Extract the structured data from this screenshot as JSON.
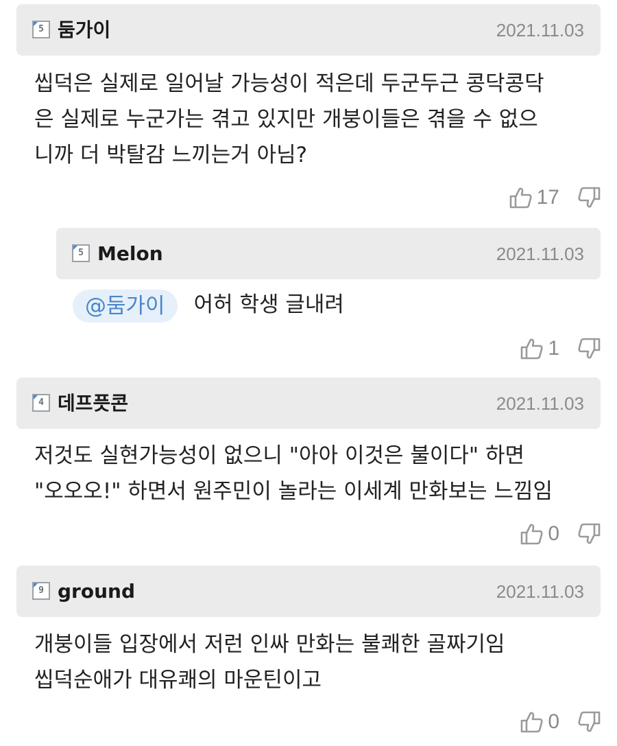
{
  "comments": [
    {
      "level": "5",
      "username": "둠가이",
      "date": "2021.11.03",
      "lines": [
        "씹덕은 실제로 일어날 가능성이 적은데 두군두근 콩닥콩닥",
        "은 실제로 누군가는 겪고 있지만 개붕이들은 겪을 수 없으",
        "니까 더 박탈감 느끼는거 아님?"
      ],
      "likes": "17",
      "reply": {
        "level": "5",
        "username": "Melon",
        "date": "2021.11.03",
        "mention": "@둠가이",
        "text": "어허 학생 글내려",
        "likes": "1"
      }
    },
    {
      "level": "4",
      "username": "데프픗콘",
      "date": "2021.11.03",
      "lines": [
        "저것도 실현가능성이 없으니 \"아아 이것은 불이다\" 하면",
        "\"오오오!\" 하면서 원주민이 놀라는 이세계 만화보는 느낌임"
      ],
      "likes": "0"
    },
    {
      "level": "9",
      "username": "ground",
      "date": "2021.11.03",
      "lines": [
        "개붕이들 입장에서 저런 인싸 만화는 불쾌한 골짜기임",
        "씹덕순애가 대유쾌의 마운틴이고"
      ],
      "likes": "0"
    }
  ],
  "icons": {
    "like": "thumbs-up-icon",
    "dislike": "thumbs-down-icon"
  }
}
